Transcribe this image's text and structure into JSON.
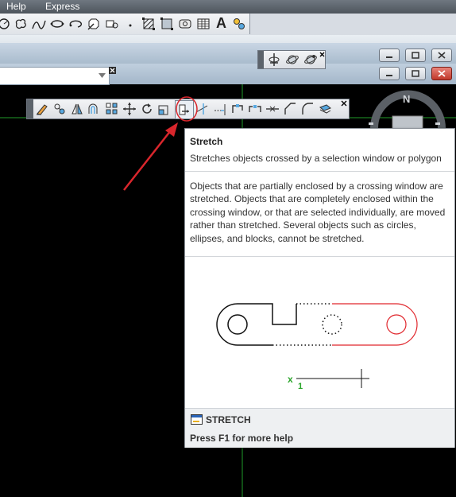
{
  "menubar": {
    "items": [
      "Help",
      "Express"
    ]
  },
  "draw_toolbar": {
    "icons": [
      "circle-icon",
      "revcloud-icon",
      "spline-icon",
      "ellipse-icon",
      "ellipse-arc-icon",
      "insert-block-icon",
      "make-block-icon",
      "point-icon",
      "hatch-icon",
      "gradient-icon",
      "region-icon",
      "table-icon",
      "multiline-text-icon",
      "add-selected-icon"
    ],
    "text_icon_glyph": "A"
  },
  "orbit_toolbar": {
    "icons": [
      "pan-icon",
      "orbit-icon",
      "free-orbit-icon"
    ]
  },
  "modify_toolbar": {
    "icons": [
      "erase-icon",
      "copy-icon",
      "mirror-icon",
      "offset-icon",
      "array-icon",
      "move-icon",
      "rotate-icon",
      "scale-icon",
      "stretch-icon",
      "trim-icon",
      "extend-icon",
      "break-at-point-icon",
      "break-icon",
      "join-icon",
      "chamfer-icon",
      "fillet-icon",
      "explode-icon"
    ],
    "highlighted": "stretch-icon"
  },
  "viewcube": {
    "compass_label": "N"
  },
  "tooltip": {
    "title": "Stretch",
    "description": "Stretches objects crossed by a selection window or polygon",
    "detail": "Objects that are partially enclosed by a crossing window are stretched. Objects that are completely enclosed within the crossing window, or that are selected individually, are moved rather than stretched. Several objects such as circles, ellipses, and blocks, cannot be stretched.",
    "illustration": {
      "marker_label": "1",
      "marker_symbol": "x"
    },
    "command": "STRETCH",
    "help_hint": "Press F1 for more help"
  },
  "colors": {
    "annotation_arrow": "#d9262c",
    "crosshair": "#1f9b2a",
    "stretch_red": "#e0262c",
    "marker_green": "#2aa52a"
  }
}
